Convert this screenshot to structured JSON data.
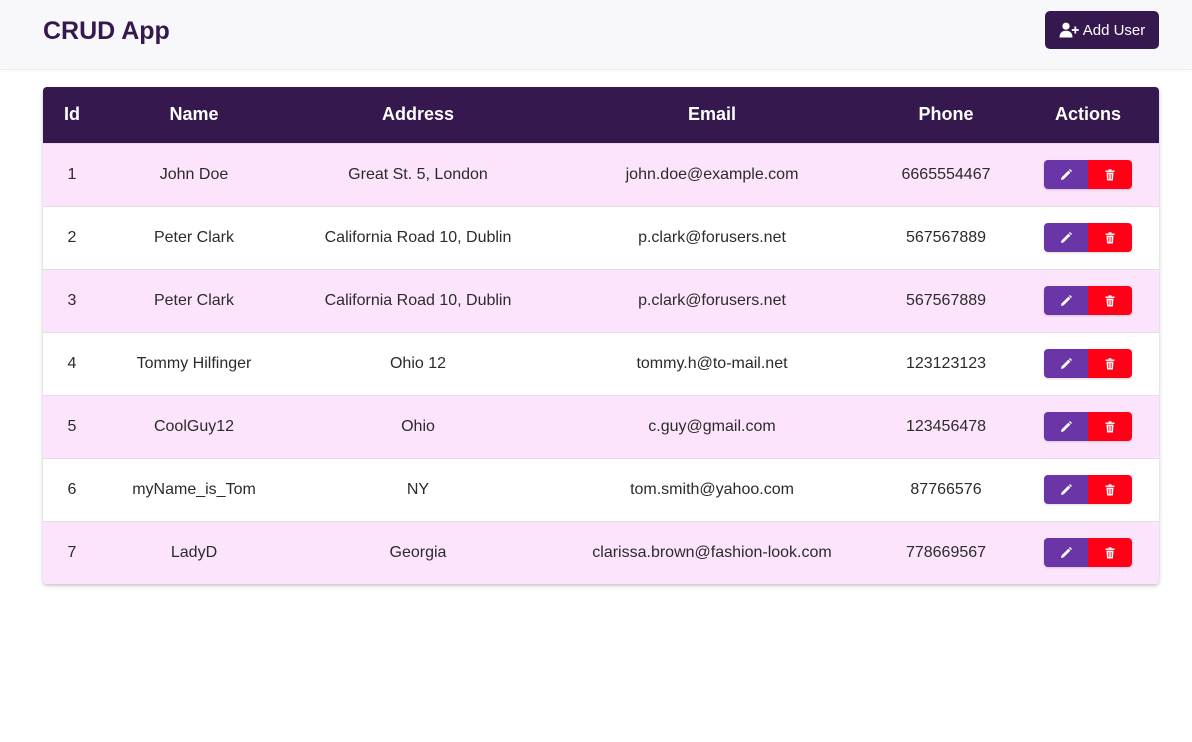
{
  "navbar": {
    "title": "CRUD App",
    "add_user_label": "Add User",
    "add_user_icon": "user-plus-icon"
  },
  "colors": {
    "brand": "#35184e",
    "row_odd": "#fce4fc",
    "row_even": "#ffffff",
    "edit": "#6a35a6",
    "delete": "#ff0016"
  },
  "table": {
    "headers": [
      "Id",
      "Name",
      "Address",
      "Email",
      "Phone",
      "Actions"
    ],
    "rows": [
      {
        "id": "1",
        "name": "John Doe",
        "address": "Great St. 5, London",
        "email": "john.doe@example.com",
        "phone": "6665554467"
      },
      {
        "id": "2",
        "name": "Peter Clark",
        "address": "California Road 10, Dublin",
        "email": "p.clark@forusers.net",
        "phone": "567567889"
      },
      {
        "id": "3",
        "name": "Peter Clark",
        "address": "California Road 10, Dublin",
        "email": "p.clark@forusers.net",
        "phone": "567567889"
      },
      {
        "id": "4",
        "name": "Tommy Hilfinger",
        "address": "Ohio 12",
        "email": "tommy.h@to-mail.net",
        "phone": "123123123"
      },
      {
        "id": "5",
        "name": "CoolGuy12",
        "address": "Ohio",
        "email": "c.guy@gmail.com",
        "phone": "123456478"
      },
      {
        "id": "6",
        "name": "myName_is_Tom",
        "address": "NY",
        "email": "tom.smith@yahoo.com",
        "phone": "87766576"
      },
      {
        "id": "7",
        "name": "LadyD",
        "address": "Georgia",
        "email": "clarissa.brown@fashion-look.com",
        "phone": "778669567"
      }
    ],
    "row_action_icons": [
      "pencil-icon",
      "trash-icon"
    ]
  }
}
